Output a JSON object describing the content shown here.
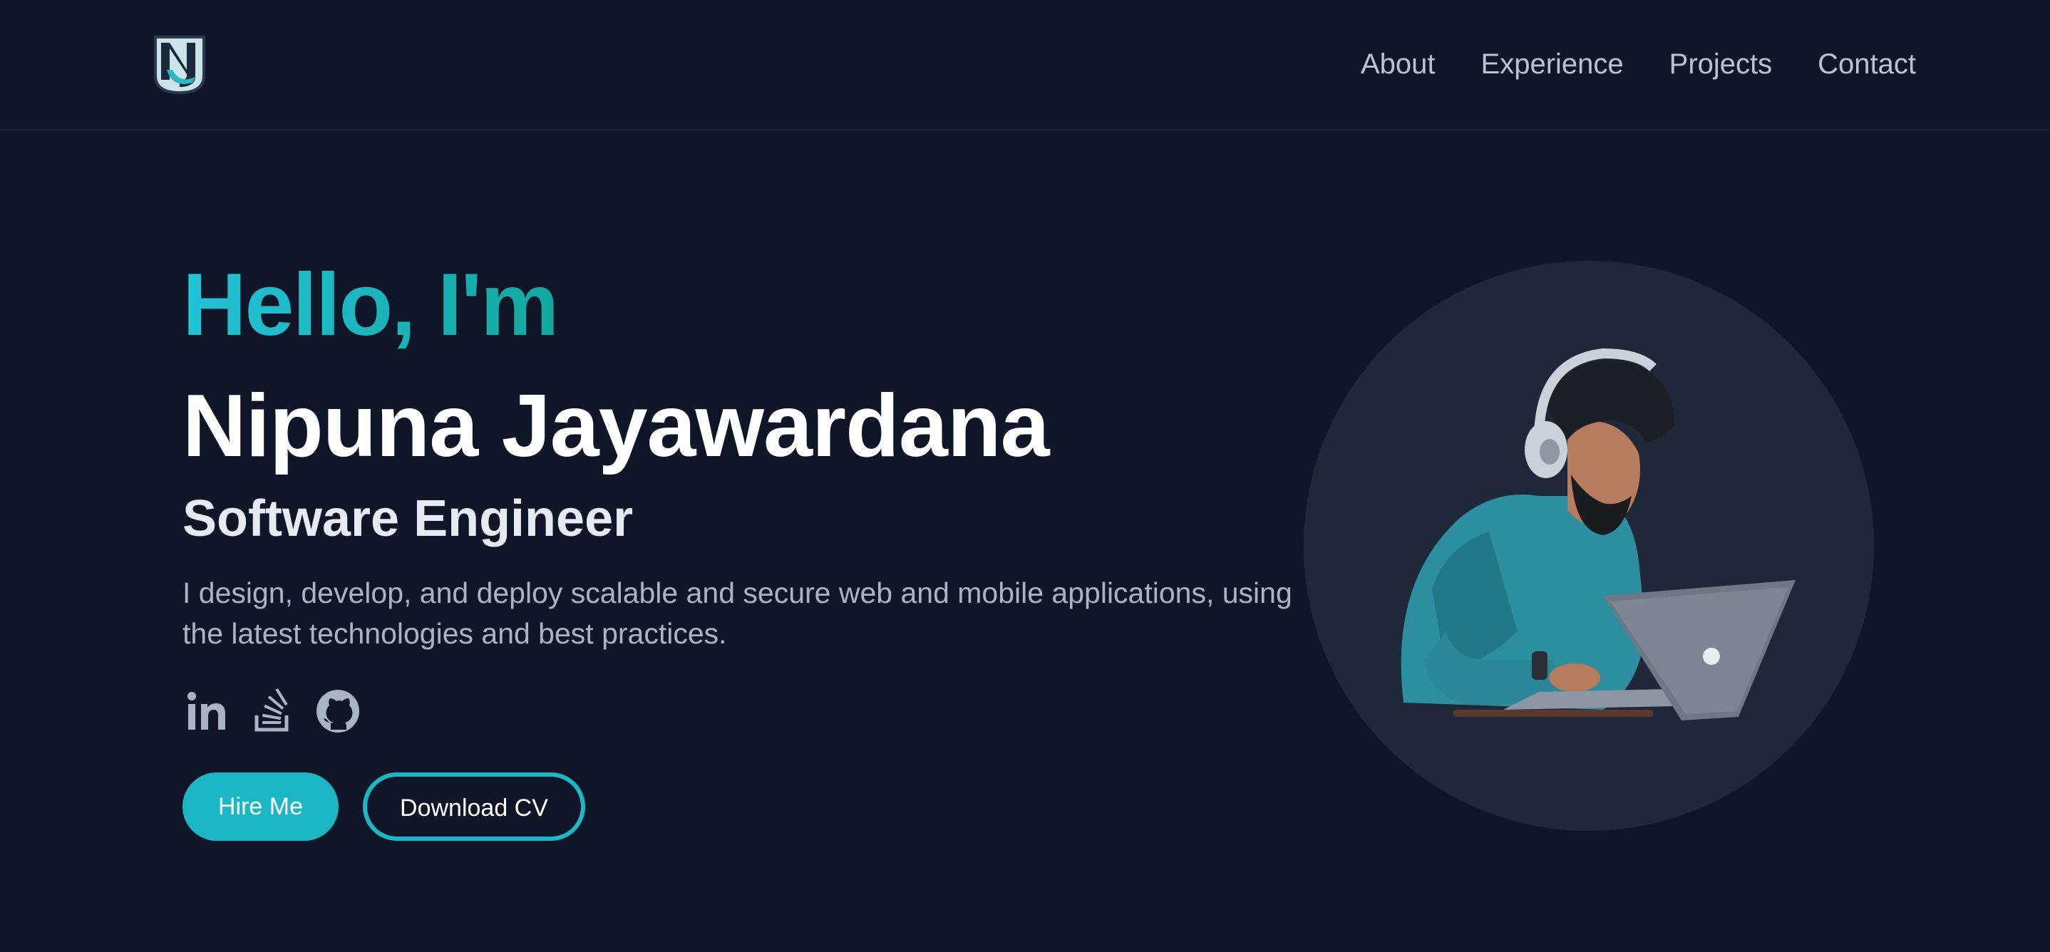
{
  "brand": {
    "logo_letters": "NJ"
  },
  "nav": {
    "items": [
      {
        "label": "About"
      },
      {
        "label": "Experience"
      },
      {
        "label": "Projects"
      },
      {
        "label": "Contact"
      }
    ]
  },
  "hero": {
    "greeting": "Hello, I'm",
    "name": "Nipuna Jayawardana",
    "role": "Software Engineer",
    "tagline": "I design, develop, and deploy scalable and secure web and mobile applications, using the latest technologies and best practices.",
    "socials": [
      {
        "icon": "linkedin-icon"
      },
      {
        "icon": "stackoverflow-icon"
      },
      {
        "icon": "github-icon"
      }
    ],
    "hire_label": "Hire Me",
    "cv_label": "Download CV"
  },
  "colors": {
    "background": "#0f1628",
    "accent": "#1bb7c4",
    "avatar_circle": "#1e2839",
    "text_muted": "#a9b4c5"
  }
}
